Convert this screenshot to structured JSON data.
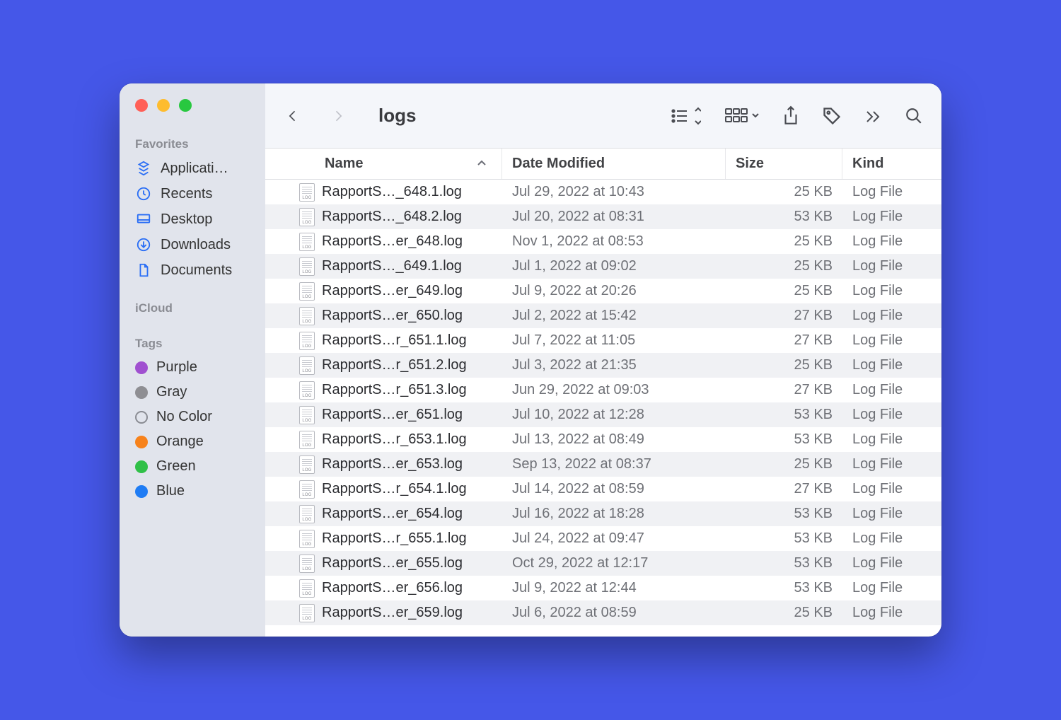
{
  "window_title": "logs",
  "sidebar": {
    "favorites_label": "Favorites",
    "items": [
      {
        "label": "Applicati…"
      },
      {
        "label": "Recents"
      },
      {
        "label": "Desktop"
      },
      {
        "label": "Downloads"
      },
      {
        "label": "Documents"
      }
    ],
    "icloud_label": "iCloud",
    "tags_label": "Tags",
    "tags": [
      {
        "label": "Purple",
        "color": "#a050d0"
      },
      {
        "label": "Gray",
        "color": "#8e8e93"
      },
      {
        "label": "No Color",
        "color": ""
      },
      {
        "label": "Orange",
        "color": "#f7821b"
      },
      {
        "label": "Green",
        "color": "#30c048"
      },
      {
        "label": "Blue",
        "color": "#1f7cf4"
      }
    ]
  },
  "columns": {
    "name": "Name",
    "date": "Date Modified",
    "size": "Size",
    "kind": "Kind"
  },
  "files": [
    {
      "name": "RapportS…_648.1.log",
      "date": "Jul 29, 2022 at 10:43",
      "size": "25 KB",
      "kind": "Log File"
    },
    {
      "name": "RapportS…_648.2.log",
      "date": "Jul 20, 2022 at 08:31",
      "size": "53 KB",
      "kind": "Log File"
    },
    {
      "name": "RapportS…er_648.log",
      "date": "Nov 1, 2022 at 08:53",
      "size": "25 KB",
      "kind": "Log File"
    },
    {
      "name": "RapportS…_649.1.log",
      "date": "Jul 1, 2022 at 09:02",
      "size": "25 KB",
      "kind": "Log File"
    },
    {
      "name": "RapportS…er_649.log",
      "date": "Jul 9, 2022 at 20:26",
      "size": "25 KB",
      "kind": "Log File"
    },
    {
      "name": "RapportS…er_650.log",
      "date": "Jul 2, 2022 at 15:42",
      "size": "27 KB",
      "kind": "Log File"
    },
    {
      "name": "RapportS…r_651.1.log",
      "date": "Jul 7, 2022 at 11:05",
      "size": "27 KB",
      "kind": "Log File"
    },
    {
      "name": "RapportS…r_651.2.log",
      "date": "Jul 3, 2022 at 21:35",
      "size": "25 KB",
      "kind": "Log File"
    },
    {
      "name": "RapportS…r_651.3.log",
      "date": "Jun 29, 2022 at 09:03",
      "size": "27 KB",
      "kind": "Log File"
    },
    {
      "name": "RapportS…er_651.log",
      "date": "Jul 10, 2022 at 12:28",
      "size": "53 KB",
      "kind": "Log File"
    },
    {
      "name": "RapportS…r_653.1.log",
      "date": "Jul 13, 2022 at 08:49",
      "size": "53 KB",
      "kind": "Log File"
    },
    {
      "name": "RapportS…er_653.log",
      "date": "Sep 13, 2022 at 08:37",
      "size": "25 KB",
      "kind": "Log File"
    },
    {
      "name": "RapportS…r_654.1.log",
      "date": "Jul 14, 2022 at 08:59",
      "size": "27 KB",
      "kind": "Log File"
    },
    {
      "name": "RapportS…er_654.log",
      "date": "Jul 16, 2022 at 18:28",
      "size": "53 KB",
      "kind": "Log File"
    },
    {
      "name": "RapportS…r_655.1.log",
      "date": "Jul 24, 2022 at 09:47",
      "size": "53 KB",
      "kind": "Log File"
    },
    {
      "name": "RapportS…er_655.log",
      "date": "Oct 29, 2022 at 12:17",
      "size": "53 KB",
      "kind": "Log File"
    },
    {
      "name": "RapportS…er_656.log",
      "date": "Jul 9, 2022 at 12:44",
      "size": "53 KB",
      "kind": "Log File"
    },
    {
      "name": "RapportS…er_659.log",
      "date": "Jul 6, 2022 at 08:59",
      "size": "25 KB",
      "kind": "Log File"
    }
  ]
}
